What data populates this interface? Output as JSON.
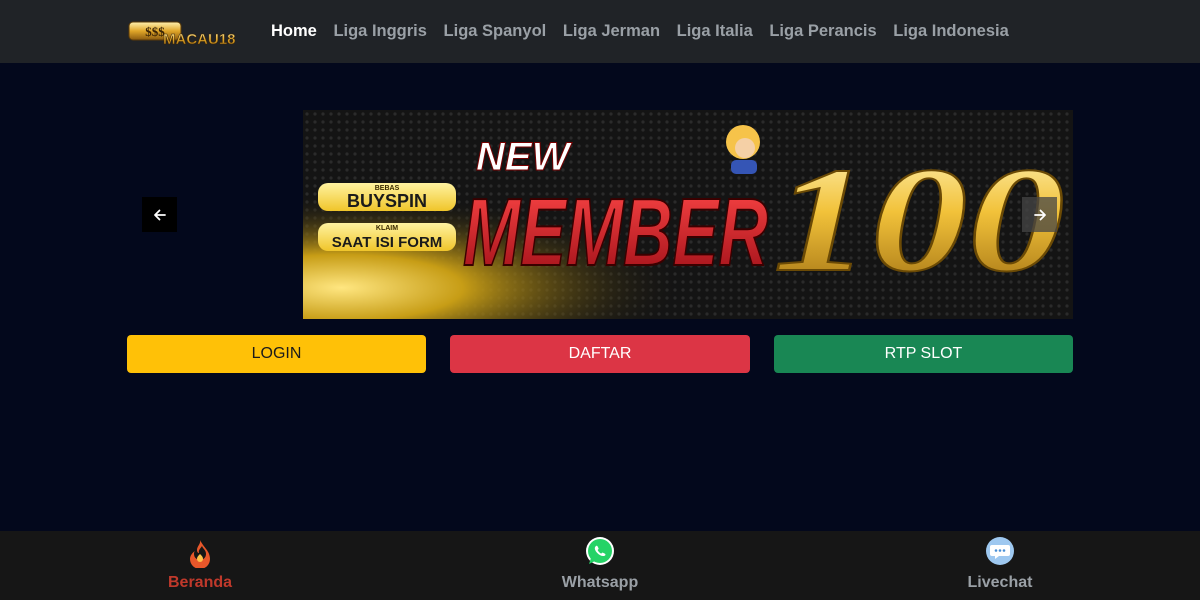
{
  "brand": {
    "logo_text": "MACAU18",
    "logo_badge": "$$$"
  },
  "nav": {
    "items": [
      {
        "label": "Home",
        "active": true
      },
      {
        "label": "Liga Inggris"
      },
      {
        "label": "Liga Spanyol"
      },
      {
        "label": "Liga Jerman"
      },
      {
        "label": "Liga Italia"
      },
      {
        "label": "Liga Perancis"
      },
      {
        "label": "Liga Indonesia"
      }
    ]
  },
  "carousel": {
    "prev_icon": "arrow-left-icon",
    "next_icon": "arrow-right-icon",
    "banner": {
      "headline_top": "NEW",
      "headline_main": "MEMBER",
      "amount": "100",
      "tag1_small": "BEBAS",
      "tag1": "BUYSPIN",
      "tag2_small": "KLAIM",
      "tag2": "SAAT ISI FORM"
    }
  },
  "actions": {
    "login": "LOGIN",
    "daftar": "DAFTAR",
    "rtp": "RTP SLOT"
  },
  "bottom_nav": {
    "items": [
      {
        "label": "Beranda",
        "icon": "fire-icon",
        "active": true
      },
      {
        "label": "Whatsapp",
        "icon": "whatsapp-icon"
      },
      {
        "label": "Livechat",
        "icon": "chat-bubble-icon"
      }
    ]
  },
  "colors": {
    "background": "#03081c",
    "navbar": "#202327",
    "login": "#ffc107",
    "daftar": "#dc3545",
    "rtp": "#198754",
    "active_bottom": "#c0392b"
  }
}
